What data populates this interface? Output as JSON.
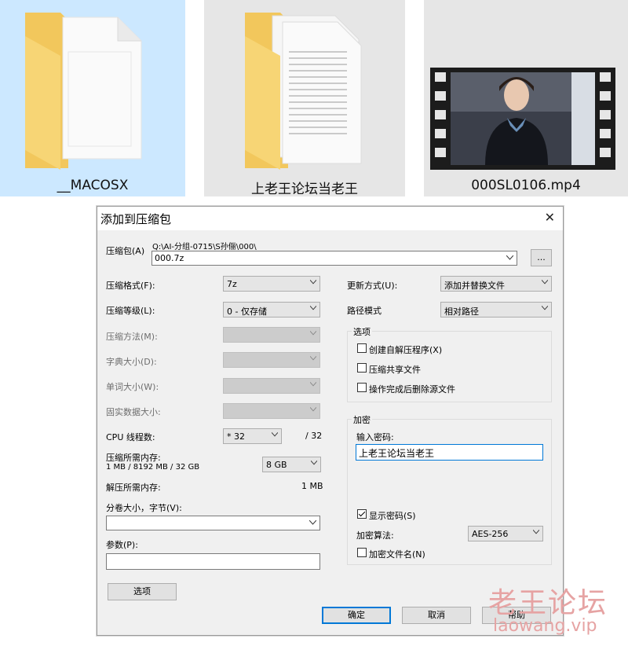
{
  "files": [
    {
      "name": "__MACOSX",
      "selected": true,
      "icon": "folder-icon"
    },
    {
      "name": "上老王论坛当老王",
      "selected": false,
      "icon": "folder-document-icon"
    },
    {
      "name": "000SL0106.mp4",
      "selected": false,
      "icon": "video-thumbnail-icon"
    }
  ],
  "dialog": {
    "title": "添加到压缩包",
    "close_glyph": "✕",
    "archive_label": "压缩包(A)",
    "archive_path": "Q:\\AI-分组-0715\\S孙俪\\000\\",
    "archive_name": "000.7z",
    "browse_label": "...",
    "left": {
      "format_label": "压缩格式(F):",
      "format_value": "7z",
      "level_label": "压缩等级(L):",
      "level_value": "0 - 仅存储",
      "method_label": "压缩方法(M):",
      "dict_label": "字典大小(D):",
      "word_label": "单词大小(W):",
      "solid_label": "固实数据大小:",
      "cpu_label": "CPU 线程数:",
      "cpu_value": "* 32",
      "cpu_max": "/ 32",
      "mem_label": "压缩所需内存:",
      "mem_detail": "1 MB / 8192 MB / 32 GB",
      "mem_value": "8 GB",
      "demem_label": "解压所需内存:",
      "demem_value": "1 MB",
      "split_label": "分卷大小，字节(V):",
      "split_value": "",
      "params_label": "参数(P):",
      "params_value": "",
      "options_button": "选项"
    },
    "right": {
      "update_label": "更新方式(U):",
      "update_value": "添加并替换文件",
      "path_label": "路径模式",
      "path_value": "相对路径",
      "options_group": "选项",
      "opt_sfx": "创建自解压程序(X)",
      "opt_shared": "压缩共享文件",
      "opt_delete": "操作完成后删除源文件",
      "encrypt_group": "加密",
      "password_label": "输入密码:",
      "password_value": "上老王论坛当老王",
      "show_password": "显示密码(S)",
      "enc_method_label": "加密算法:",
      "enc_method_value": "AES-256",
      "enc_names": "加密文件名(N)"
    },
    "buttons": {
      "ok": "确定",
      "cancel": "取消",
      "help": "帮助"
    }
  },
  "watermark": {
    "line1": "老王论坛",
    "line2": "laowang.vip"
  },
  "colors": {
    "selected_tile": "#cce8ff",
    "tile_bg": "#e6e6e6",
    "accent": "#0078d7",
    "watermark": "#e8a0a0"
  }
}
